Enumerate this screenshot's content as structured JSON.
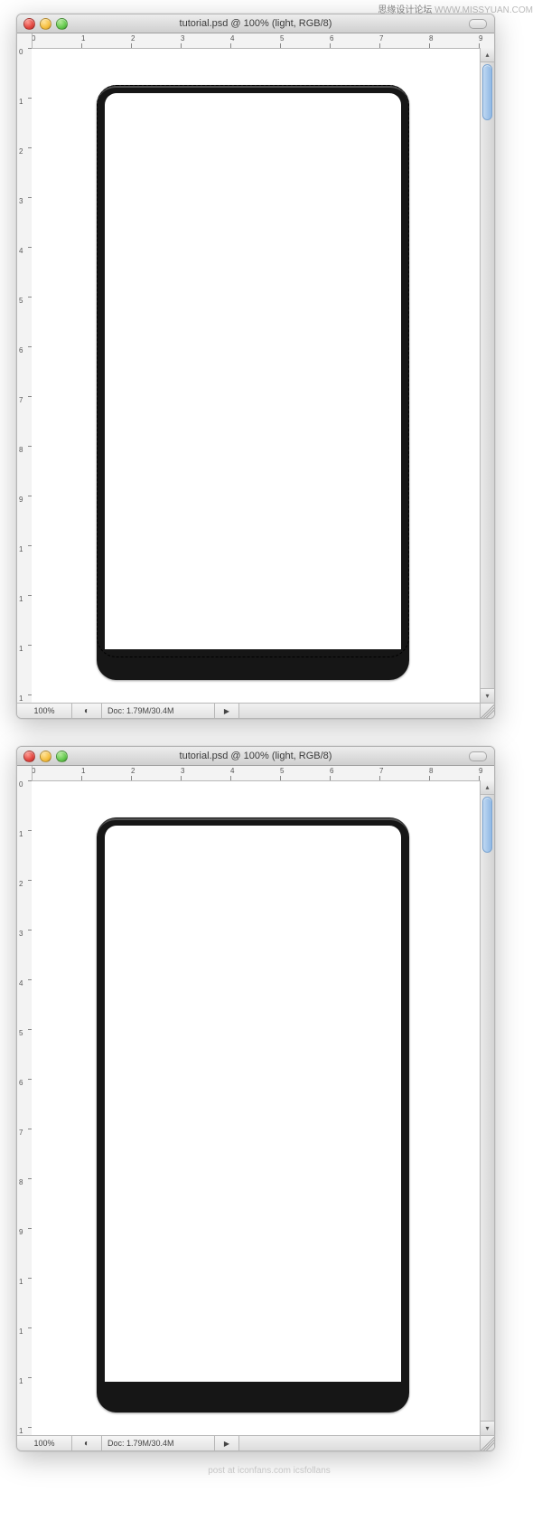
{
  "page": {
    "top_watermark_bold": "思缘设计论坛",
    "top_watermark_url": "WWW.MISSYUAN.COM",
    "footer_watermark": "post at iconfans.com icsfollans"
  },
  "window_a": {
    "title": "tutorial.psd @ 100% (light, RGB/8)",
    "zoom": "100%",
    "doc_label": "Doc: 1.79M/30.4M",
    "ruler_h_ticks": [
      "0",
      "1",
      "2",
      "3",
      "4",
      "5",
      "6",
      "7",
      "8",
      "9"
    ],
    "ruler_v_ticks": [
      "0",
      "1",
      "2",
      "3",
      "4",
      "5",
      "6",
      "7",
      "8",
      "9",
      "1",
      "1",
      "1",
      "1"
    ]
  },
  "window_b": {
    "title": "tutorial.psd @ 100% (light, RGB/8)",
    "zoom": "100%",
    "doc_label": "Doc: 1.79M/30.4M",
    "ruler_h_ticks": [
      "0",
      "1",
      "2",
      "3",
      "4",
      "5",
      "6",
      "7",
      "8",
      "9"
    ],
    "ruler_v_ticks": [
      "0",
      "1",
      "2",
      "3",
      "4",
      "5",
      "6",
      "7",
      "8",
      "9",
      "1",
      "1",
      "1",
      "1"
    ]
  }
}
